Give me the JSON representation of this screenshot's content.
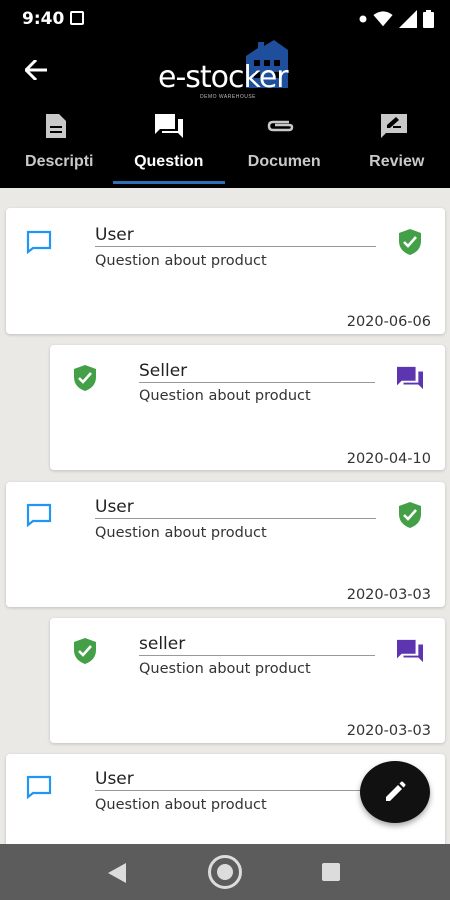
{
  "status_bar": {
    "time": "9:40",
    "icons": [
      "image-icon",
      "dot-icon",
      "wifi-icon",
      "signal-icon",
      "battery-icon"
    ]
  },
  "app_bar": {
    "back_icon": "arrow-left-icon",
    "logo_text": "e-stocker",
    "logo_subtext": "DEMO WAREHOUSE"
  },
  "tabs": [
    {
      "label": "Descripti",
      "icon": "description-icon",
      "active": false
    },
    {
      "label": "Question",
      "icon": "forum-icon",
      "active": true
    },
    {
      "label": "Documen",
      "icon": "attachment-icon",
      "active": false
    },
    {
      "label": "Review",
      "icon": "rate-review-icon",
      "active": false
    }
  ],
  "questions": [
    {
      "author": "User",
      "text": "Question about product",
      "date": "2020-06-06",
      "type": "user"
    },
    {
      "author": "Seller",
      "text": "Question about product",
      "date": "2020-04-10",
      "type": "seller"
    },
    {
      "author": "User",
      "text": "Question about product",
      "date": "2020-03-03",
      "type": "user"
    },
    {
      "author": "seller",
      "text": "Question about product",
      "date": "2020-03-03",
      "type": "seller"
    },
    {
      "author": "User",
      "text": "Question about product",
      "date": "",
      "type": "user"
    }
  ],
  "fab": {
    "icon": "edit-pencil-icon"
  },
  "colors": {
    "accent": "#2f6fb3",
    "user_icon": "#2196f3",
    "shield": "#43a047",
    "seller_icon": "#5e35b1"
  }
}
